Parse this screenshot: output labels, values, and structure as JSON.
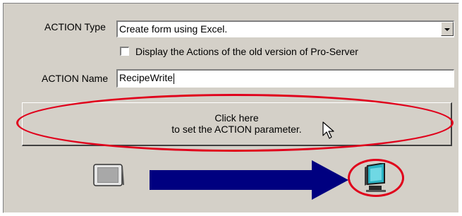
{
  "form": {
    "action_type_label": "ACTION Type",
    "action_type_value": "Create form using Excel.",
    "old_version_checkbox_label": "Display the Actions of the old version of Pro-Server",
    "old_version_checked": false,
    "action_name_label": "ACTION Name",
    "action_name_value": "RecipeWrite"
  },
  "param_button": {
    "line1": "Click here",
    "line2": "to set the ACTION parameter."
  },
  "icons": {
    "source": "panel-display-icon",
    "arrow": "right-arrow",
    "destination": "pc-monitor-icon"
  },
  "colors": {
    "panel_bg": "#d4d0c8",
    "highlight": "#e0001b",
    "arrow": "#000080",
    "monitor_screen": "#2bb3c4"
  }
}
